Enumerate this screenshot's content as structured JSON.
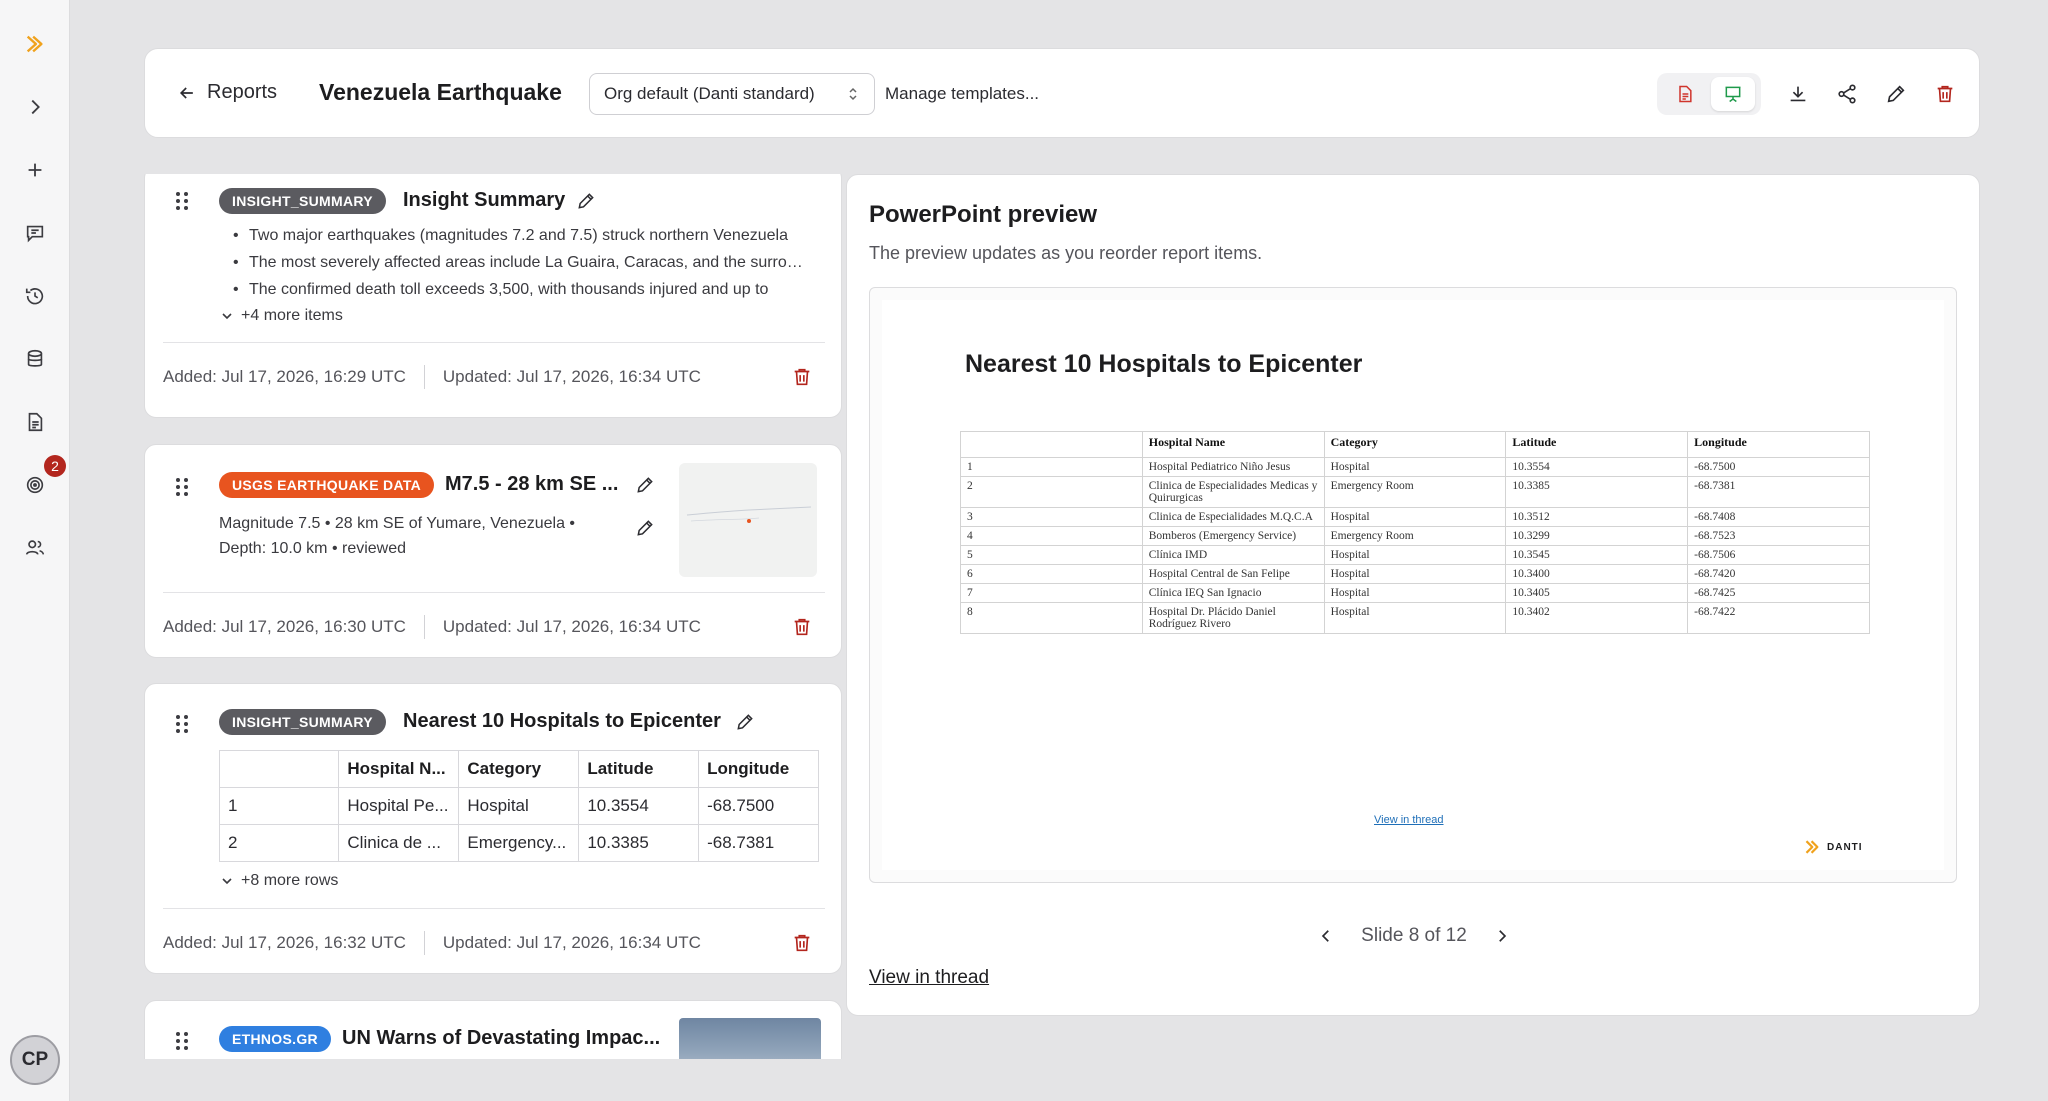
{
  "header": {
    "back_label": "Reports",
    "title": "Venezuela Earthquake",
    "template_select": "Org default (Danti standard)",
    "manage_templates": "Manage templates..."
  },
  "rail": {
    "badge_count": "2",
    "avatar_initials": "CP"
  },
  "cards": [
    {
      "tag": "INSIGHT_SUMMARY",
      "tag_color": "#5b5b60",
      "title": "Insight Summary",
      "bullets": [
        "Two major earthquakes (magnitudes 7.2 and 7.5) struck northern Venezuela",
        "The most severely affected areas include La Guaira, Caracas, and the surrounding region",
        "The confirmed death toll exceeds 3,500, with thousands injured and up to"
      ],
      "more": "+4 more items",
      "added": "Added: Jul 17, 2026, 16:29 UTC",
      "updated": "Updated: Jul 17, 2026, 16:34 UTC"
    },
    {
      "tag": "USGS EARTHQUAKE DATA",
      "tag_color": "#e8541f",
      "title": "M7.5 - 28 km SE ...",
      "description": "Magnitude 7.5 • 28 km SE of Yumare, Venezuela • Depth: 10.0 km • reviewed",
      "added": "Added: Jul 17, 2026, 16:30 UTC",
      "updated": "Updated: Jul 17, 2026, 16:34 UTC"
    },
    {
      "tag": "INSIGHT_SUMMARY",
      "tag_color": "#5b5b60",
      "title": "Nearest 10 Hospitals to Epicenter",
      "columns": [
        "",
        "Hospital N...",
        "Category",
        "Latitude",
        "Longitude"
      ],
      "rows": [
        [
          "1",
          "Hospital Pe...",
          "Hospital",
          "10.3554",
          "-68.7500"
        ],
        [
          "2",
          "Clinica de ...",
          "Emergency...",
          "10.3385",
          "-68.7381"
        ]
      ],
      "more": "+8 more rows",
      "added": "Added: Jul 17, 2026, 16:32 UTC",
      "updated": "Updated: Jul 17, 2026, 16:34 UTC"
    },
    {
      "tag": "ETHNOS.GR",
      "tag_color": "#2f7fe0",
      "title": "UN Warns of Devastating Impac..."
    }
  ],
  "preview": {
    "title": "PowerPoint preview",
    "subtitle": "The preview updates as you reorder report items.",
    "slide_title": "Nearest 10 Hospitals to Epicenter",
    "slide_columns": [
      "",
      "Hospital Name",
      "Category",
      "Latitude",
      "Longitude"
    ],
    "slide_rows": [
      [
        "1",
        "Hospital Pediatrico Niño Jesus",
        "Hospital",
        "10.3554",
        "-68.7500"
      ],
      [
        "2",
        "Clinica de Especialidades Medicas y Quirurgicas",
        "Emergency Room",
        "10.3385",
        "-68.7381"
      ],
      [
        "3",
        "Clinica de Especialidades M.Q.C.A",
        "Hospital",
        "10.3512",
        "-68.7408"
      ],
      [
        "4",
        "Bomberos (Emergency Service)",
        "Emergency Room",
        "10.3299",
        "-68.7523"
      ],
      [
        "5",
        "Clínica IMD",
        "Hospital",
        "10.3545",
        "-68.7506"
      ],
      [
        "6",
        "Hospital Central de San Felipe",
        "Hospital",
        "10.3400",
        "-68.7420"
      ],
      [
        "7",
        "Clínica IEQ San Ignacio",
        "Hospital",
        "10.3405",
        "-68.7425"
      ],
      [
        "8",
        "Hospital Dr. Plácido Daniel Rodríguez Rivero",
        "Hospital",
        "10.3402",
        "-68.7422"
      ]
    ],
    "slide_link": "View in thread",
    "slide_logo": "DANTI",
    "pager": "Slide 8 of 12",
    "link": "View in thread"
  }
}
